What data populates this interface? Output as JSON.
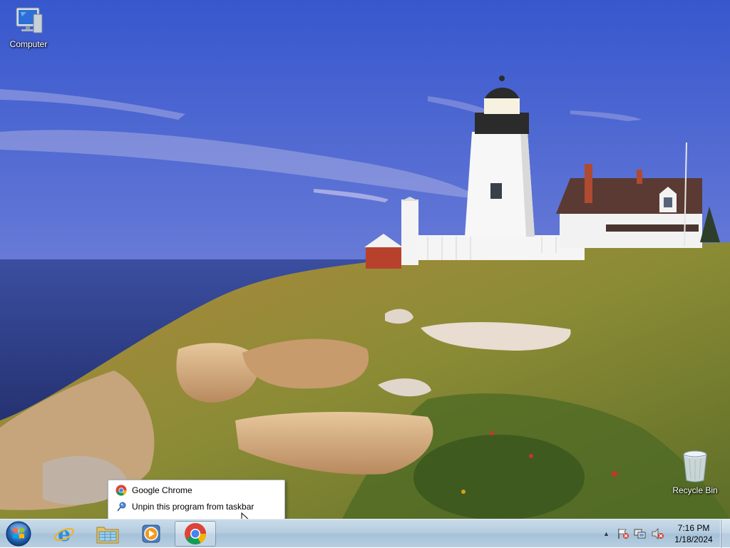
{
  "desktop": {
    "icons": [
      {
        "label": "Computer",
        "icon": "computer-icon"
      },
      {
        "label": "Recycle Bin",
        "icon": "recycle-bin-icon"
      }
    ]
  },
  "jumplist": {
    "items": [
      {
        "label": "Google Chrome",
        "icon": "chrome-icon"
      },
      {
        "label": "Unpin this program from taskbar",
        "icon": "unpin-icon"
      }
    ]
  },
  "taskbar": {
    "start": {
      "icon": "windows-start-orb"
    },
    "pinned": [
      {
        "name": "Internet Explorer",
        "icon": "internet-explorer-icon"
      },
      {
        "name": "Windows Explorer",
        "icon": "file-explorer-icon"
      },
      {
        "name": "Windows Media Player",
        "icon": "media-player-icon"
      },
      {
        "name": "Google Chrome",
        "icon": "chrome-icon",
        "state": "hovered"
      }
    ],
    "tray": {
      "icons": [
        "show-hidden-icons-chevron",
        "action-center-flag-icon",
        "network-icon",
        "volume-muted-icon"
      ],
      "time": "7:16 PM",
      "date": "1/18/2024"
    }
  },
  "colors": {
    "sky_top": "#3f5fce",
    "sky_bottom": "#a78cc7",
    "sea": "#334a9a",
    "grass": "#8d8a3a",
    "taskbar": "#b5cde0",
    "menu_border": "#a8b4c4"
  }
}
